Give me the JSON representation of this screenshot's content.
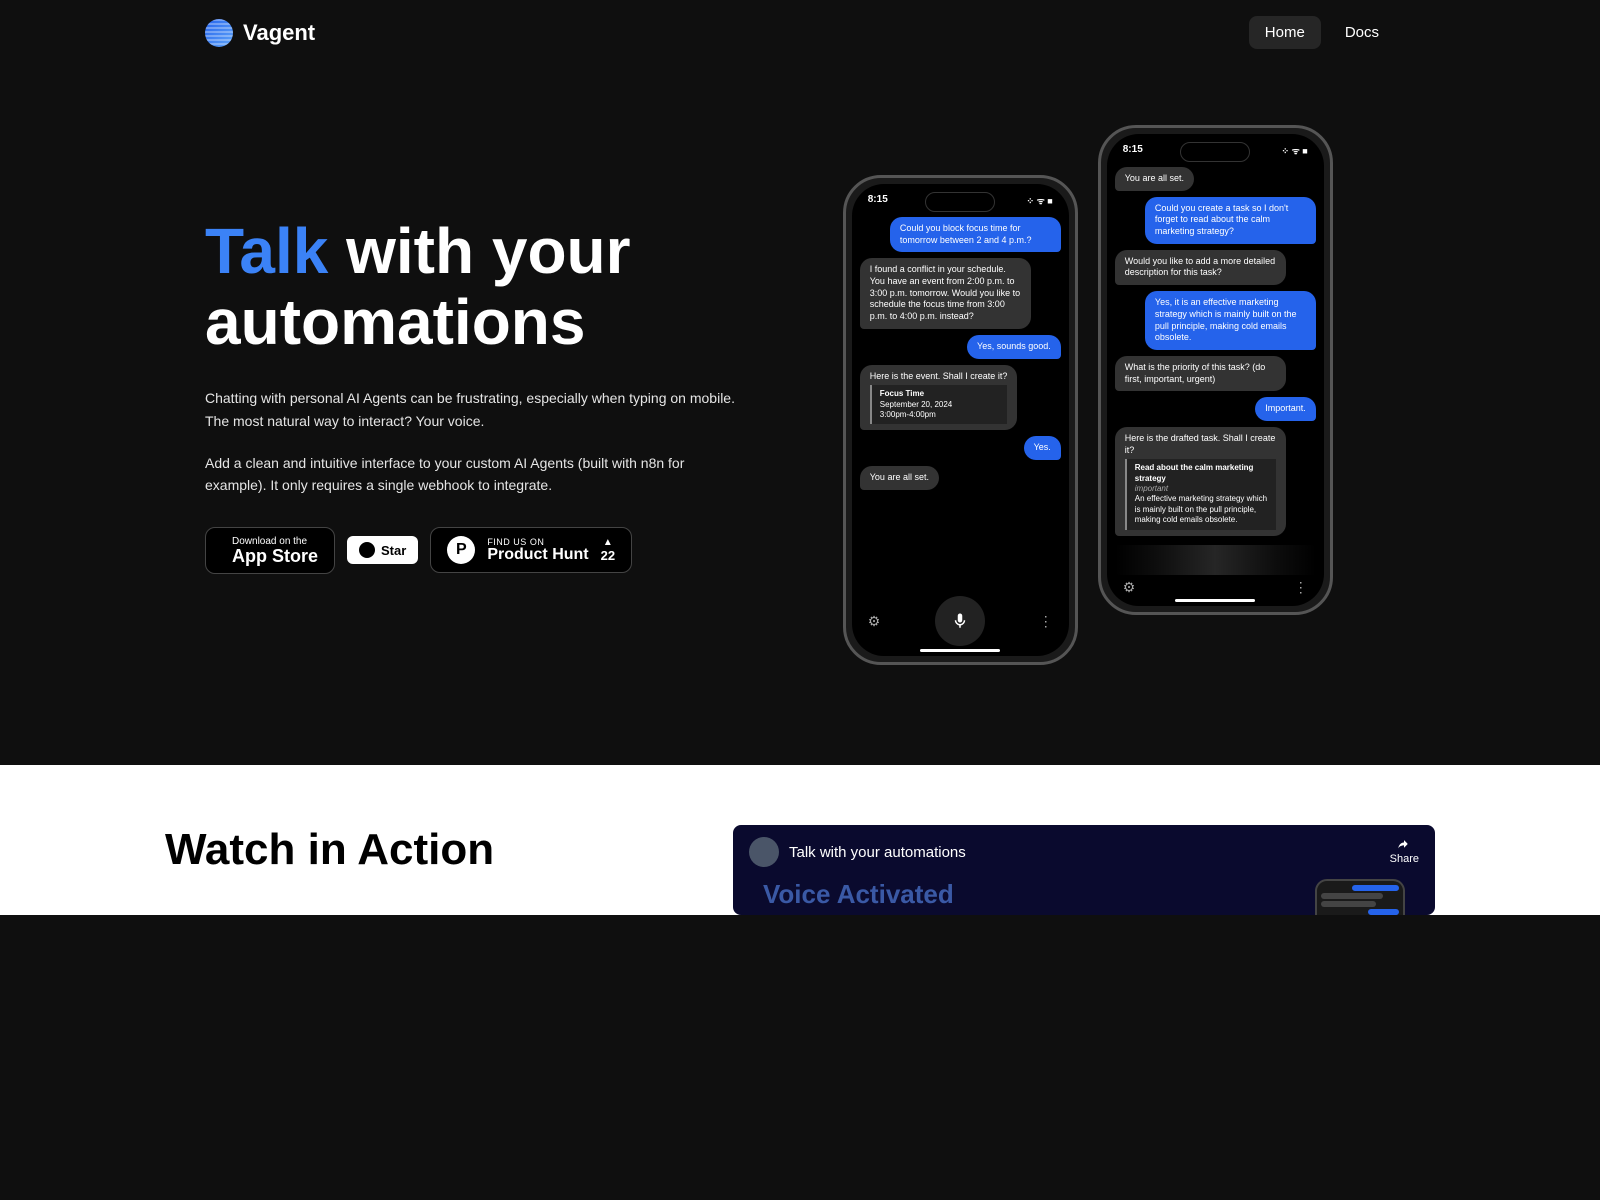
{
  "brand": "Vagent",
  "nav": {
    "home": "Home",
    "docs": "Docs"
  },
  "hero": {
    "title_accent": "Talk",
    "title_rest": " with your automations",
    "desc1": "Chatting with personal AI Agents can be frustrating, especially when typing on mobile. The most natural way to interact? Your voice.",
    "desc2": "Add a clean and intuitive interface to your custom AI Agents (built with n8n for example). It only requires a single webhook to integrate."
  },
  "buttons": {
    "appstore_small": "Download on the",
    "appstore_big": "App Store",
    "github": "Star",
    "ph_small": "FIND US ON",
    "ph_big": "Product Hunt",
    "ph_count": "22"
  },
  "phone1": {
    "time": "8:15",
    "msgs": {
      "m1": "Could you block focus time for tomorrow between 2 and 4 p.m.?",
      "m2": "I found a conflict in your schedule. You have an event from 2:00 p.m. to 3:00 p.m. tomorrow. Would you like to schedule the focus time from 3:00 p.m. to 4:00 p.m. instead?",
      "m3": "Yes, sounds good.",
      "m4": "Here is the event. Shall I create it?",
      "card_title": "Focus Time",
      "card_date": "September 20, 2024",
      "card_time": "3:00pm-4:00pm",
      "m5": "Yes.",
      "m6": "You are all set."
    }
  },
  "phone2": {
    "time": "8:15",
    "msgs": {
      "m0": "You are all set.",
      "m1": "Could you create a task so I don't forget to read about the calm marketing strategy?",
      "m2": "Would you like to add a more detailed description for this task?",
      "m3": "Yes, it is an effective marketing strategy which is mainly built on the pull principle, making cold emails obsolete.",
      "m4": "What is the priority of this task? (do first, important, urgent)",
      "m5": "Important.",
      "m6": "Here is the drafted task. Shall I create it?",
      "card_title": "Read about the calm marketing strategy",
      "card_prio": "important",
      "card_desc": "An effective marketing strategy which is mainly built on the pull principle, making cold emails obsolete."
    }
  },
  "section2": {
    "heading": "Watch in Action",
    "video_title": "Talk with your automations",
    "share": "Share",
    "video_overlay": "Voice Activated"
  }
}
